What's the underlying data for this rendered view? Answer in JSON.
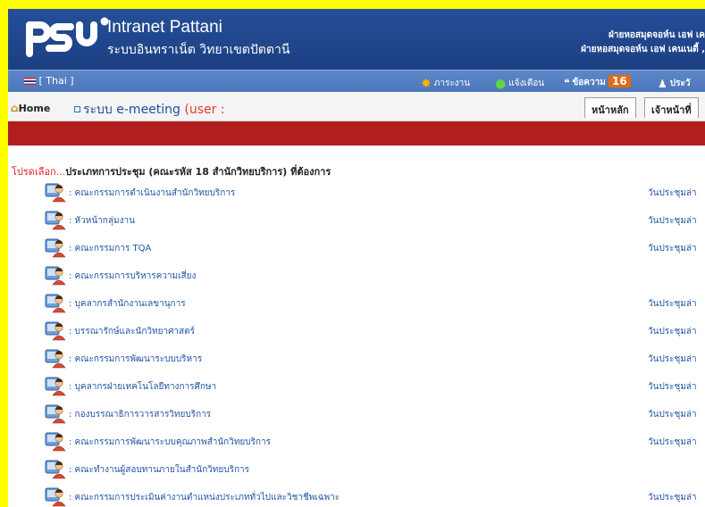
{
  "header": {
    "title": "Intranet Pattani",
    "subtitle": "ระบบอินทราเน็ต วิทยาเขตปัตตานี",
    "user_line_1": "ฝ่ายหอสมุดจอห์น เอฟ เค",
    "user_line_2": "ฝ่ายหอสมุดจอห์น เอฟ เคนเนดี้ ,"
  },
  "navbar": {
    "language": "[ Thai ]",
    "items": [
      {
        "label": "ภาระงาน",
        "icon": "sun-icon"
      },
      {
        "label": "แจ้งเตือน",
        "icon": "globe-icon"
      },
      {
        "label": "ข้อความ",
        "icon": "chat-bubble-icon",
        "badge": "16"
      },
      {
        "label": "ประวั",
        "icon": "users-icon"
      }
    ]
  },
  "breadcrumb": {
    "home": "Home",
    "current": "ระบบ e-meeting",
    "user_suffix": "(user :"
  },
  "tabs": [
    "หน้าหลัก",
    "เจ้าหน้าที่"
  ],
  "content": {
    "heading_lead": "โปรดเลือก...",
    "heading_rest": "ประเภทการประชุม (คณะรหัส 18 สำนักวิทยบริการ) ที่ต้องการ",
    "meeting_items": [
      {
        "label": ": คณะกรรมการดำเนินงานสำนักวิทยบริการ",
        "meeting_date": "วันประชุมล่า"
      },
      {
        "label": ": หัวหน้ากลุ่มงาน",
        "meeting_date": "วันประชุมล่า"
      },
      {
        "label": ": คณะกรรมการ TQA",
        "meeting_date": "วันประชุมล่า"
      },
      {
        "label": ": คณะกรรมการบริหารความเสี่ยง",
        "meeting_date": ""
      },
      {
        "label": ": บุคลากรสำนักงานเลขานุการ",
        "meeting_date": "วันประชุมล่า"
      },
      {
        "label": ": บรรณารักษ์และนักวิทยาศาสตร์",
        "meeting_date": "วันประชุมล่า"
      },
      {
        "label": ": คณะกรรมการพัฒนาระบบบริหาร",
        "meeting_date": "วันประชุมล่า"
      },
      {
        "label": ": บุคลากรฝ่ายเทคโนโลยีทางการศึกษา",
        "meeting_date": "วันประชุมล่า"
      },
      {
        "label": ": กองบรรณาธิการวารสารวิทยบริการ",
        "meeting_date": "วันประชุมล่า"
      },
      {
        "label": ": คณะกรรมการพัฒนาระบบคุณภาพสำนักวิทยบริการ",
        "meeting_date": "วันประชุมล่า"
      },
      {
        "label": ": คณะทำงานผู้สอบทานภายในสำนักวิทยบริการ",
        "meeting_date": ""
      },
      {
        "label": ": คณะกรรมการประเมินค่างานตำแหน่งประเภททั่วไปและวิชาชีพเฉพาะ",
        "meeting_date": "วันประชุมล่า"
      }
    ]
  }
}
